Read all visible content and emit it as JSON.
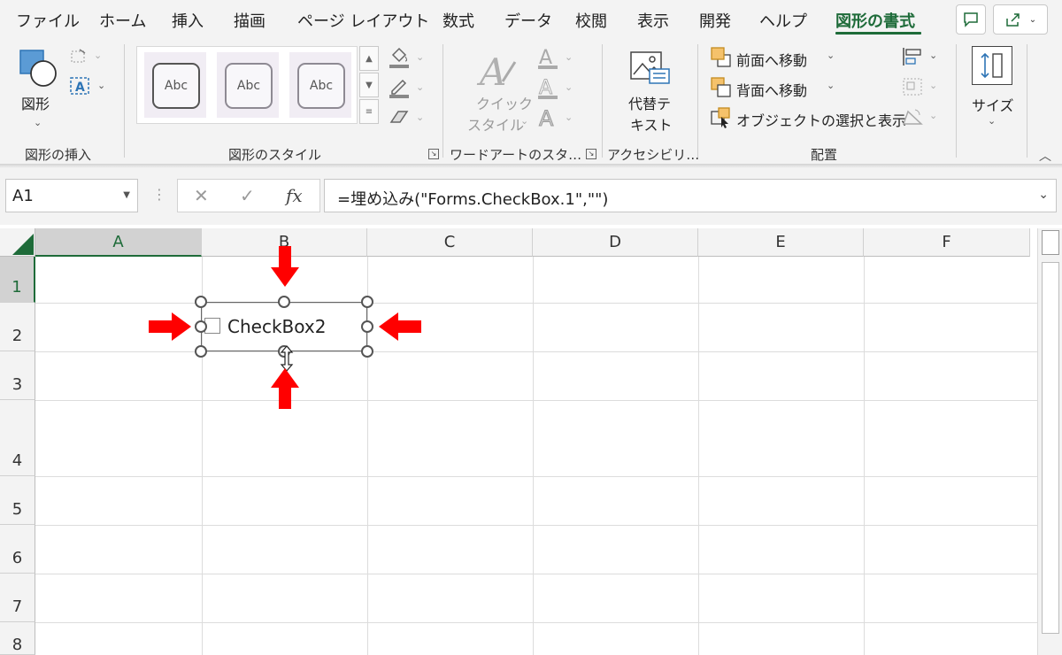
{
  "ribbon_tabs": [
    "ファイル",
    "ホーム",
    "挿入",
    "描画",
    "ページ レイアウト",
    "数式",
    "データ",
    "校閲",
    "表示",
    "開発",
    "ヘルプ",
    "図形の書式"
  ],
  "active_tab": "図形の書式",
  "groups": {
    "insert_shapes": {
      "label": "図形の挿入",
      "shapes_button": "図形"
    },
    "shape_styles": {
      "label": "図形のスタイル",
      "gallery": [
        "Abc",
        "Abc",
        "Abc"
      ]
    },
    "wordart": {
      "label": "ワードアートのスタ…",
      "quick_styles_line1": "クイック",
      "quick_styles_line2": "スタイル"
    },
    "accessibility": {
      "label": "アクセシビリ…",
      "alt_text_line1": "代替テ",
      "alt_text_line2": "キスト"
    },
    "arrange": {
      "label": "配置",
      "bring_forward": "前面へ移動",
      "send_backward": "背面へ移動",
      "selection_pane": "オブジェクトの選択と表示"
    },
    "size": {
      "label": "サイズ"
    }
  },
  "formula_bar": {
    "name_box": "A1",
    "fx": "fx",
    "formula": "=埋め込み(\"Forms.CheckBox.1\",\"\")"
  },
  "columns": [
    "A",
    "B",
    "C",
    "D",
    "E",
    "F"
  ],
  "rows": [
    "1",
    "2",
    "3",
    "4",
    "5",
    "6",
    "7",
    "8"
  ],
  "checkbox_label": "CheckBox2",
  "colors": {
    "accent": "#1e6b39",
    "arrow": "#ff0000"
  }
}
